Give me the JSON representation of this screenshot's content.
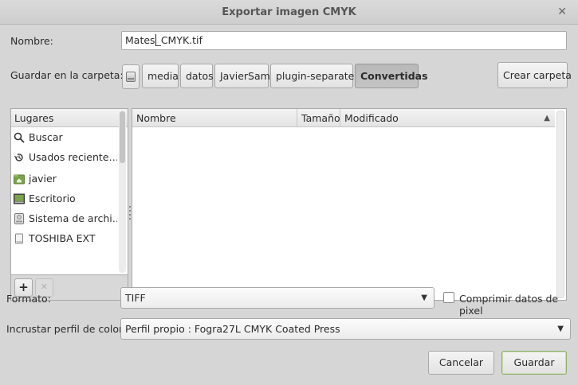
{
  "window": {
    "title": "Exportar imagen CMYK",
    "close_glyph": "✕"
  },
  "name_row": {
    "label": "Nombre:",
    "value_before_caret": "Mates",
    "value_after_caret": "_CMYK.tif"
  },
  "folder_row": {
    "label": "Guardar en la carpeta:",
    "path": [
      "media",
      "datos",
      "JavierSam",
      "plugin-separate",
      "Convertidas"
    ],
    "create_folder": "Crear carpeta"
  },
  "places": {
    "header": "Lugares",
    "items": [
      {
        "label": "Buscar",
        "icon": "search-icon"
      },
      {
        "label": "Usados reciente…",
        "icon": "recent-icon"
      },
      {
        "label": "javier",
        "icon": "home-folder-icon"
      },
      {
        "label": "Escritorio",
        "icon": "desktop-icon"
      },
      {
        "label": "Sistema de archi…",
        "icon": "filesystem-icon"
      },
      {
        "label": "TOSHIBA EXT",
        "icon": "drive-icon"
      }
    ],
    "add_glyph": "+",
    "remove_glyph": "✕"
  },
  "files": {
    "columns": {
      "name": "Nombre",
      "size": "Tamaño",
      "modified": "Modificado"
    },
    "sort_glyph": "▲"
  },
  "format_row": {
    "label": "Formato:",
    "value": "TIFF",
    "checkbox_label": "Comprimir datos de pixel",
    "checked": false
  },
  "profile_row": {
    "label": "Incrustar perfil de color:",
    "value": "Perfil propio : Fogra27L CMYK Coated Press"
  },
  "actions": {
    "cancel": "Cancelar",
    "save": "Guardar"
  },
  "dropdown_glyph": "▼",
  "colors": {
    "folder_green": "#7aa34a",
    "default_button_border": "#8eb06a"
  }
}
